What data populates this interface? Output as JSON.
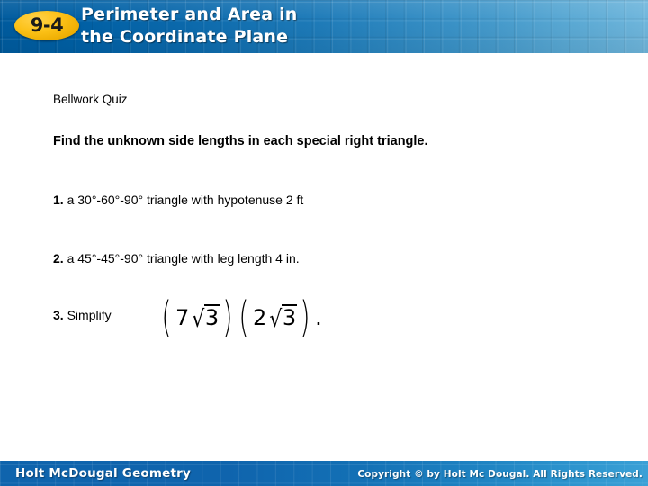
{
  "header": {
    "badge_label": "9-4",
    "title_line1": "Perimeter and Area in",
    "title_line2": "the Coordinate Plane",
    "bg_start_color": "#005b9e",
    "bg_end_color": "#6fb6dc",
    "badge_color": "#fcc117",
    "title_color": "#ffffff"
  },
  "body": {
    "section_label": "Bellwork Quiz",
    "prompt": "Find the unknown side lengths in each special right triangle.",
    "questions": [
      {
        "number": "1.",
        "text": "a 30°-60°-90° triangle with hypotenuse 2 ft"
      },
      {
        "number": "2.",
        "text": "a 45°-45°-90° triangle with leg length 4 in."
      },
      {
        "number": "3.",
        "text": "Simplify"
      }
    ],
    "math": {
      "expression": "(7√3)(2√3).",
      "open_paren_1": "(",
      "factor_1_coefficient": "7",
      "factor_1_radicand": "3",
      "close_paren_1": ")",
      "open_paren_2": "(",
      "factor_2_coefficient": "2",
      "factor_2_radicand": "3",
      "close_paren_2": ")",
      "radical_symbol": "√",
      "trailing_period": "."
    }
  },
  "footer": {
    "brand": "Holt McDougal Geometry",
    "copyright": "Copyright © by Holt Mc Dougal. All Rights Reserved.",
    "bg_color": "#0f64ad",
    "text_color": "#ffffff"
  }
}
